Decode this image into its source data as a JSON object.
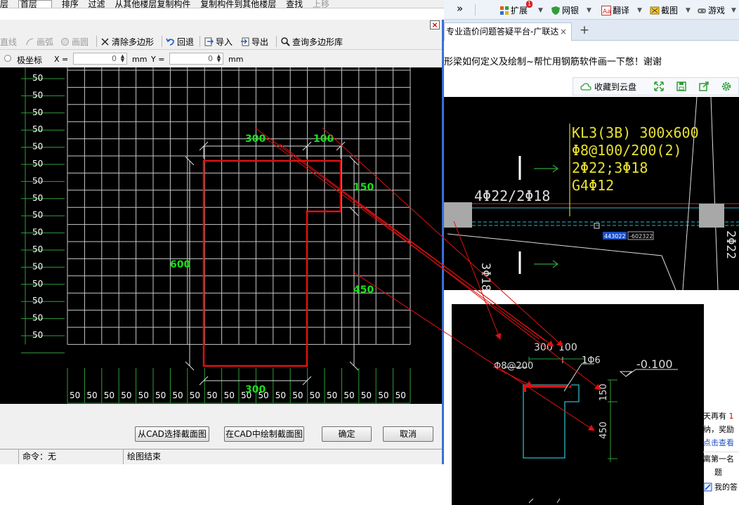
{
  "app_top": {
    "left_cut": "层",
    "layer_value": "首层",
    "sort_label": "排序",
    "filter_label": "过滤",
    "copy_from_other": "从其他楼层复制构件",
    "copy_to_other": "复制构件到其他楼层",
    "find_label": "查找",
    "move_up_label": "上移"
  },
  "dialog": {
    "close_glyph": "×",
    "toolbar": {
      "line": "直线",
      "arc": "画弧",
      "circle": "画圆",
      "clear_polygon": "清除多边形",
      "undo": "回退",
      "import": "导入",
      "export": "导出",
      "query_polygon_lib": "查询多边形库"
    },
    "coord": {
      "polar_label": "极坐标",
      "x_label": "X =",
      "x_value": "0",
      "x_unit": "mm",
      "y_label": "Y =",
      "y_value": "0",
      "y_unit": "mm"
    },
    "canvas": {
      "grid_value": "50",
      "dim_top_left": "300",
      "dim_top_right": "100",
      "dim_right_upper": "150",
      "dim_right_lower": "450",
      "dim_left": "600",
      "dim_bottom": "300",
      "grid_color": "#c8c8c8",
      "shape_color": "#e01010",
      "dim_text_color": "#18e018"
    },
    "buttons": {
      "select_from_cad": "从CAD选择截面图",
      "draw_in_cad": "在CAD中绘制截面图",
      "ok": "确定",
      "cancel": "取消"
    },
    "status": {
      "command": "命令：无",
      "message": "绘图结束"
    }
  },
  "browser": {
    "toolbar": {
      "more": "»",
      "extensions": "扩展",
      "extensions_badge": "1",
      "bank": "网银",
      "translate": "翻译",
      "screenshot": "截图",
      "games": "游戏"
    },
    "tab_title": "专业造价问题答疑平台-广联达",
    "tab_close": "×",
    "new_tab": "+",
    "headline": "形梁如何定义及绘制~帮忙用钢筋软件画一下憋！谢谢",
    "save_to_cloud": "收藏到云盘",
    "cad1": {
      "beam_label": "KL3(3B) 300x600",
      "stirrup": "Φ8@100/200(2)",
      "rebar": "2Φ22;3Φ18",
      "side_rebar": "G4Φ12",
      "left_rebar": "4Φ22/2Φ18",
      "vertical_rebar": "3Φ18",
      "vertical_rebar2": "2Φ22",
      "input_a": "443022",
      "input_b": "-602322"
    },
    "cad2": {
      "dim_300": "300",
      "dim_100": "100",
      "stirrup": "Φ8@200",
      "rebar_1": "1Φ6",
      "level": "-0.100",
      "dim_150": "150",
      "dim_450": "450"
    },
    "side": {
      "line1": "天再有",
      "line1_num": "1",
      "line2": "纳，奖励",
      "line3": "点击查看",
      "line4": "离第一名",
      "line5": "题",
      "line6": "我的答"
    }
  }
}
